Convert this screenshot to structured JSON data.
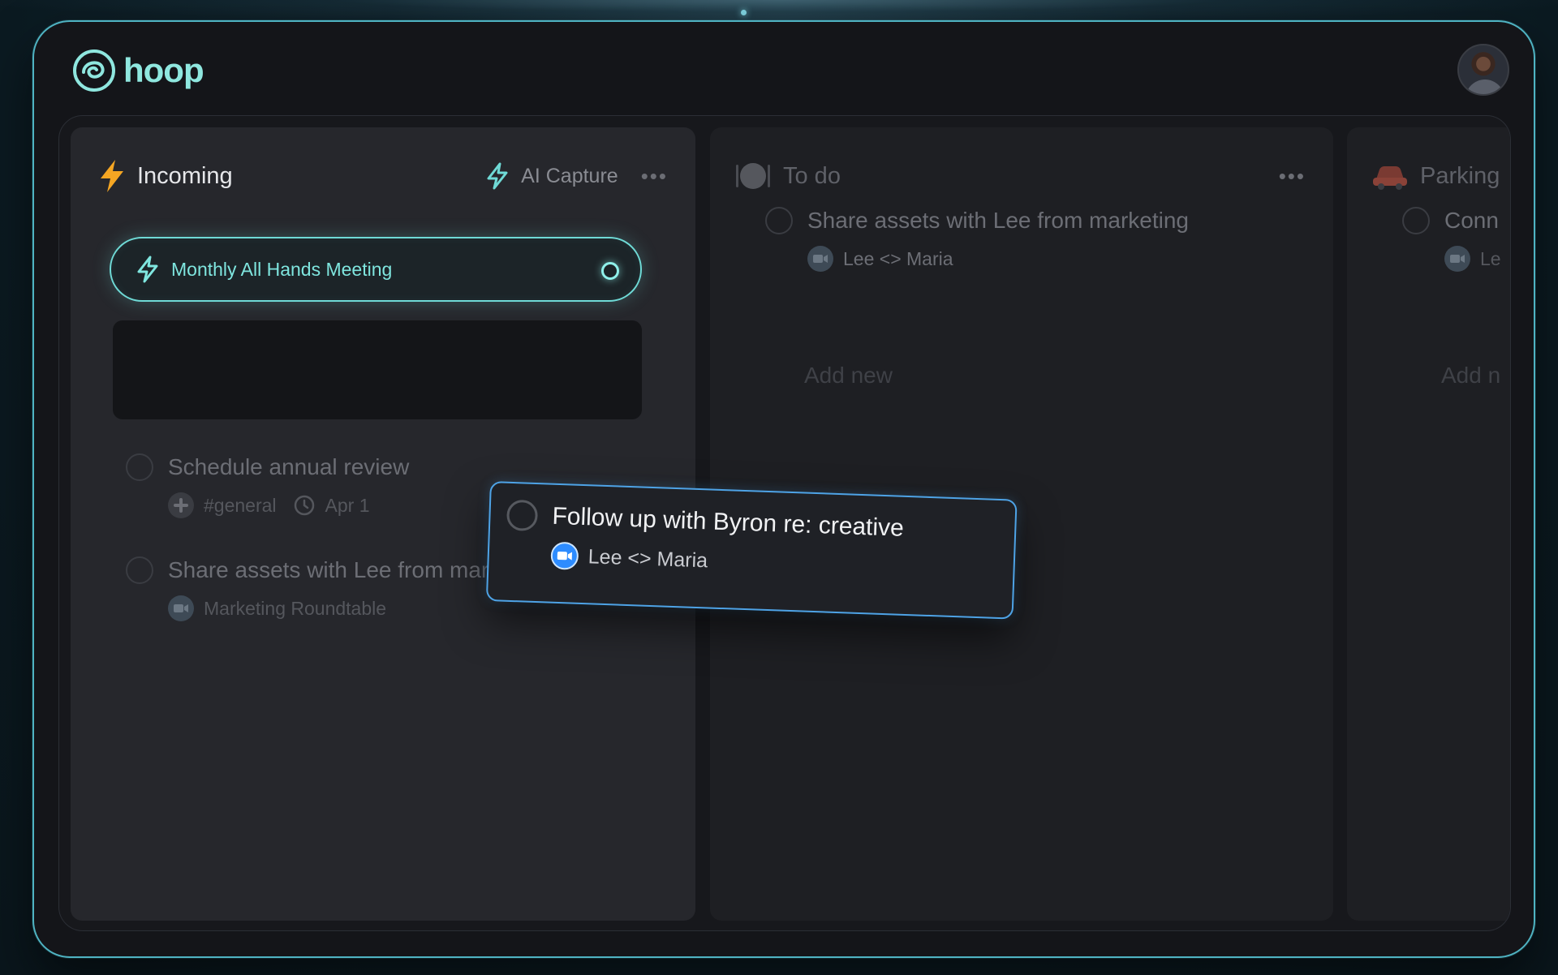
{
  "app": {
    "name": "hoop"
  },
  "columns": {
    "incoming": {
      "title": "Incoming",
      "ai_capture_label": "AI Capture",
      "more_label": "•••",
      "capture_pill": {
        "label": "Monthly All Hands Meeting"
      },
      "tasks": [
        {
          "title": "Schedule annual review",
          "channel": "#general",
          "date": "Apr 1"
        },
        {
          "title": "Share assets with Lee from marketing",
          "meeting": "Marketing Roundtable"
        }
      ]
    },
    "todo": {
      "title": "To do",
      "more_label": "•••",
      "tasks": [
        {
          "title": "Share assets with Lee from marketing",
          "meeting": "Lee <> Maria"
        }
      ],
      "add_new_label": "Add new"
    },
    "parking": {
      "title": "Parking",
      "task_title_partial": "Conn",
      "meeting_partial": "Le",
      "add_new_partial": "Add n"
    }
  },
  "dragging_card": {
    "title": "Follow up with Byron re: creative",
    "meeting": "Lee <> Maria"
  },
  "colors": {
    "accent_teal": "#6fdad6",
    "drag_border_blue": "#4ea3e6",
    "lightning_orange": "#f5a623"
  }
}
